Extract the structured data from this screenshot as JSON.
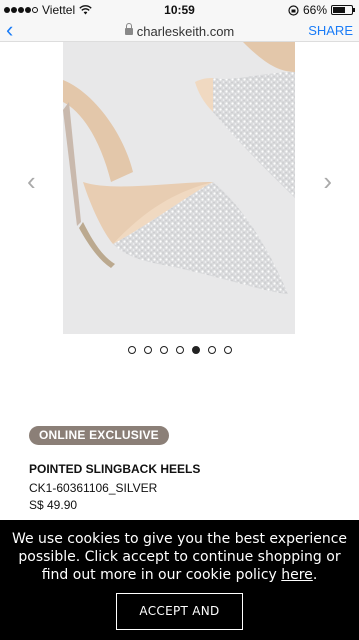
{
  "status": {
    "carrier": "Viettel",
    "time": "10:59",
    "battery": "66%",
    "battery_level": 0.66
  },
  "browser": {
    "url": "charleskeith.com",
    "share_label": "SHARE"
  },
  "gallery": {
    "image_count": 7,
    "active_index": 4
  },
  "product": {
    "badge": "ONLINE EXCLUSIVE",
    "name": "POINTED SLINGBACK HEELS",
    "sku": "CK1-60361106_SILVER",
    "price": "S$ 49.90"
  },
  "cookie": {
    "text_before": "We use cookies to give you the best experience possible. Click accept to continue shopping or find out more in our cookie policy ",
    "link": "here",
    "text_after": ".",
    "button": "ACCEPT AND CLOSE"
  },
  "colors": {
    "accent": "#1a7cf7",
    "badge": "#8b7f77",
    "banner": "#000000"
  }
}
